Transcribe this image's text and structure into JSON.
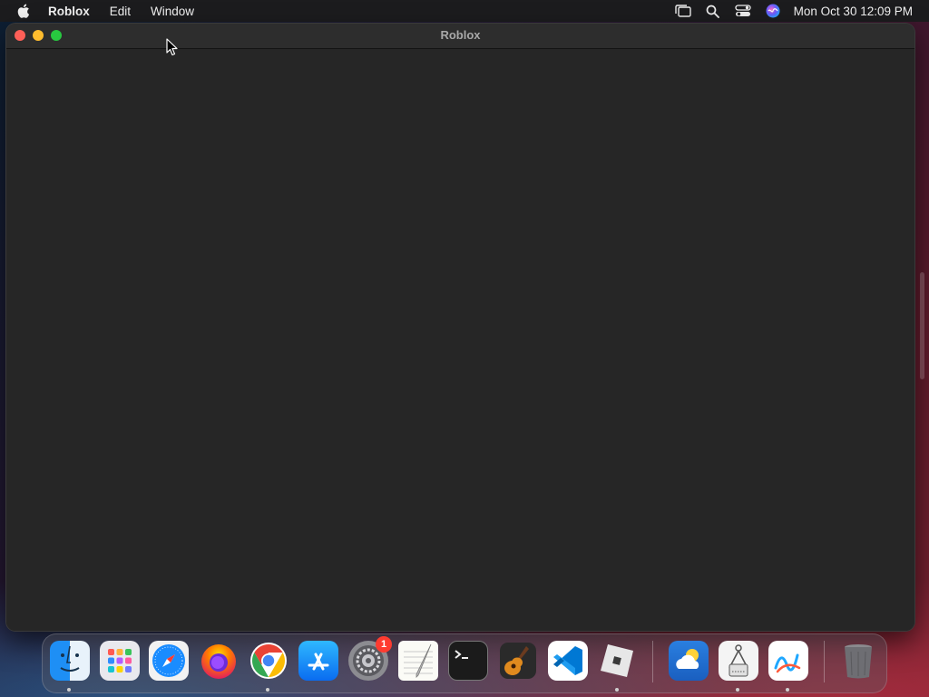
{
  "menubar": {
    "app_name": "Roblox",
    "items": [
      {
        "label": "Edit"
      },
      {
        "label": "Window"
      }
    ],
    "clock": "Mon Oct 30  12:09 PM",
    "status_icons": [
      "stage-manager-icon",
      "spotlight-search-icon",
      "control-center-icon",
      "siri-icon"
    ]
  },
  "window": {
    "title": "Roblox",
    "buttons": [
      "close-button",
      "minimize-button",
      "zoom-button"
    ]
  },
  "dock": {
    "apps": [
      {
        "name": "Finder",
        "icon": "finder-icon",
        "running": true
      },
      {
        "name": "Launchpad",
        "icon": "launchpad-icon",
        "running": false
      },
      {
        "name": "Safari",
        "icon": "safari-icon",
        "running": false
      },
      {
        "name": "Firefox",
        "icon": "firefox-icon",
        "running": false
      },
      {
        "name": "Google Chrome",
        "icon": "chrome-icon",
        "running": true
      },
      {
        "name": "App Store",
        "icon": "app-store-icon",
        "running": false
      },
      {
        "name": "System Settings",
        "icon": "system-settings-icon",
        "running": false,
        "badge": "1"
      },
      {
        "name": "TextEdit",
        "icon": "textedit-icon",
        "running": false
      },
      {
        "name": "Terminal",
        "icon": "terminal-icon",
        "running": false
      },
      {
        "name": "GarageBand",
        "icon": "garageband-icon",
        "running": false
      },
      {
        "name": "Visual Studio Code",
        "icon": "vscode-icon",
        "running": false
      },
      {
        "name": "Roblox",
        "icon": "roblox-icon",
        "running": true
      },
      {
        "name": "Weather",
        "icon": "weather-icon",
        "running": false
      },
      {
        "name": "Screenshot Utility",
        "icon": "screenshot-utility-icon",
        "running": true
      },
      {
        "name": "Freeform",
        "icon": "freeform-icon",
        "running": true
      },
      {
        "name": "Trash",
        "icon": "trash-icon",
        "running": false
      }
    ]
  },
  "colors": {
    "window_bg": "#262626",
    "menubar_bg": "#1c1c1e",
    "close": "#fe5f57",
    "minimize": "#febc2e",
    "zoom": "#28c840",
    "badge": "#ff3b30"
  }
}
